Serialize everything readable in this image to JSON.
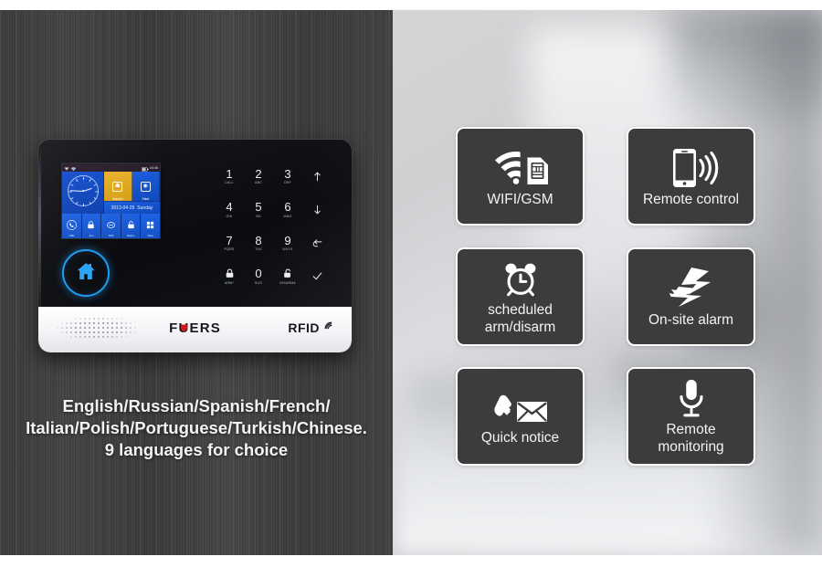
{
  "left": {
    "device": {
      "brand": "FUERS",
      "brand_u": "U",
      "brand_pre": "F",
      "brand_post": "ERS",
      "rfid_label": "RFID",
      "lcd": {
        "time": "04:46",
        "date": "2013-04-29",
        "weekday": "Sunday",
        "tiles": [
          {
            "label": "Stay Arm",
            "icon": "home-arm-icon",
            "color": "#e8b12a"
          },
          {
            "label": "Patrol",
            "icon": "globe-icon",
            "color": "#1a5ddd"
          }
        ],
        "icon_row": [
          {
            "label": "Calls",
            "icon": "phone-icon"
          },
          {
            "label": "Arm",
            "icon": "lock-icon"
          },
          {
            "label": "SOS",
            "icon": "sos-icon"
          },
          {
            "label": "Disarm",
            "icon": "unlock-icon"
          },
          {
            "label": "More",
            "icon": "grid-icon"
          }
        ],
        "status_icons": [
          "signal-icon",
          "wifi-icon",
          "battery-icon"
        ]
      },
      "home_button_icon": "home-icon",
      "keypad": [
        {
          "num": "1",
          "sub": "CALL",
          "type": "number"
        },
        {
          "num": "2",
          "sub": "ABC",
          "type": "number"
        },
        {
          "num": "3",
          "sub": "DEF",
          "type": "number"
        },
        {
          "num": "",
          "sub": "",
          "type": "icon",
          "icon": "arrow-up-icon"
        },
        {
          "num": "4",
          "sub": "GHI",
          "type": "number"
        },
        {
          "num": "5",
          "sub": "JKL",
          "type": "number"
        },
        {
          "num": "6",
          "sub": "MNO",
          "type": "number"
        },
        {
          "num": "",
          "sub": "",
          "type": "icon",
          "icon": "arrow-down-icon"
        },
        {
          "num": "7",
          "sub": "PQRS",
          "type": "number"
        },
        {
          "num": "8",
          "sub": "TUV",
          "type": "number"
        },
        {
          "num": "9",
          "sub": "WXYZ",
          "type": "number"
        },
        {
          "num": "",
          "sub": "",
          "type": "icon",
          "icon": "back-arrow-icon"
        },
        {
          "num": "",
          "sub": "ARM*",
          "type": "icon",
          "icon": "lock-closed-icon"
        },
        {
          "num": "0",
          "sub": "SOS",
          "type": "number"
        },
        {
          "num": "",
          "sub": "DISARM#",
          "type": "icon",
          "icon": "lock-open-icon"
        },
        {
          "num": "",
          "sub": "",
          "type": "icon",
          "icon": "check-icon"
        }
      ]
    },
    "caption": {
      "line1": "English/Russian/Spanish/French/",
      "line2": "Italian/Polish/Portuguese/Turkish/Chinese.",
      "line3": "9 languages for choice"
    }
  },
  "right": {
    "cards": [
      {
        "id": "wifi",
        "label": "WIFI/GSM",
        "icon": "wifi-sim-icon"
      },
      {
        "id": "remote",
        "label": "Remote control",
        "icon": "phone-signal-icon"
      },
      {
        "id": "sched",
        "label": "scheduled\narm/disarm",
        "line1": "scheduled",
        "line2": "arm/disarm",
        "icon": "alarm-clock-icon"
      },
      {
        "id": "onsite",
        "label": "On-site alarm",
        "icon": "lightning-burst-icon"
      },
      {
        "id": "quick",
        "label": "Quick notice",
        "icon": "phone-envelope-icon"
      },
      {
        "id": "mon",
        "label": "Remote\nmonitoring",
        "line1": "Remote",
        "line2": "monitoring",
        "icon": "microphone-icon"
      }
    ]
  },
  "colors": {
    "card_bg": "#3c3c3c",
    "card_border": "#ffffff",
    "wood_dark": "#3d3d3d",
    "lcd_blue": "#1450c2",
    "lcd_amber": "#e8b12a",
    "home_blue": "#1e9bf0",
    "brand_red": "#cc1822"
  }
}
